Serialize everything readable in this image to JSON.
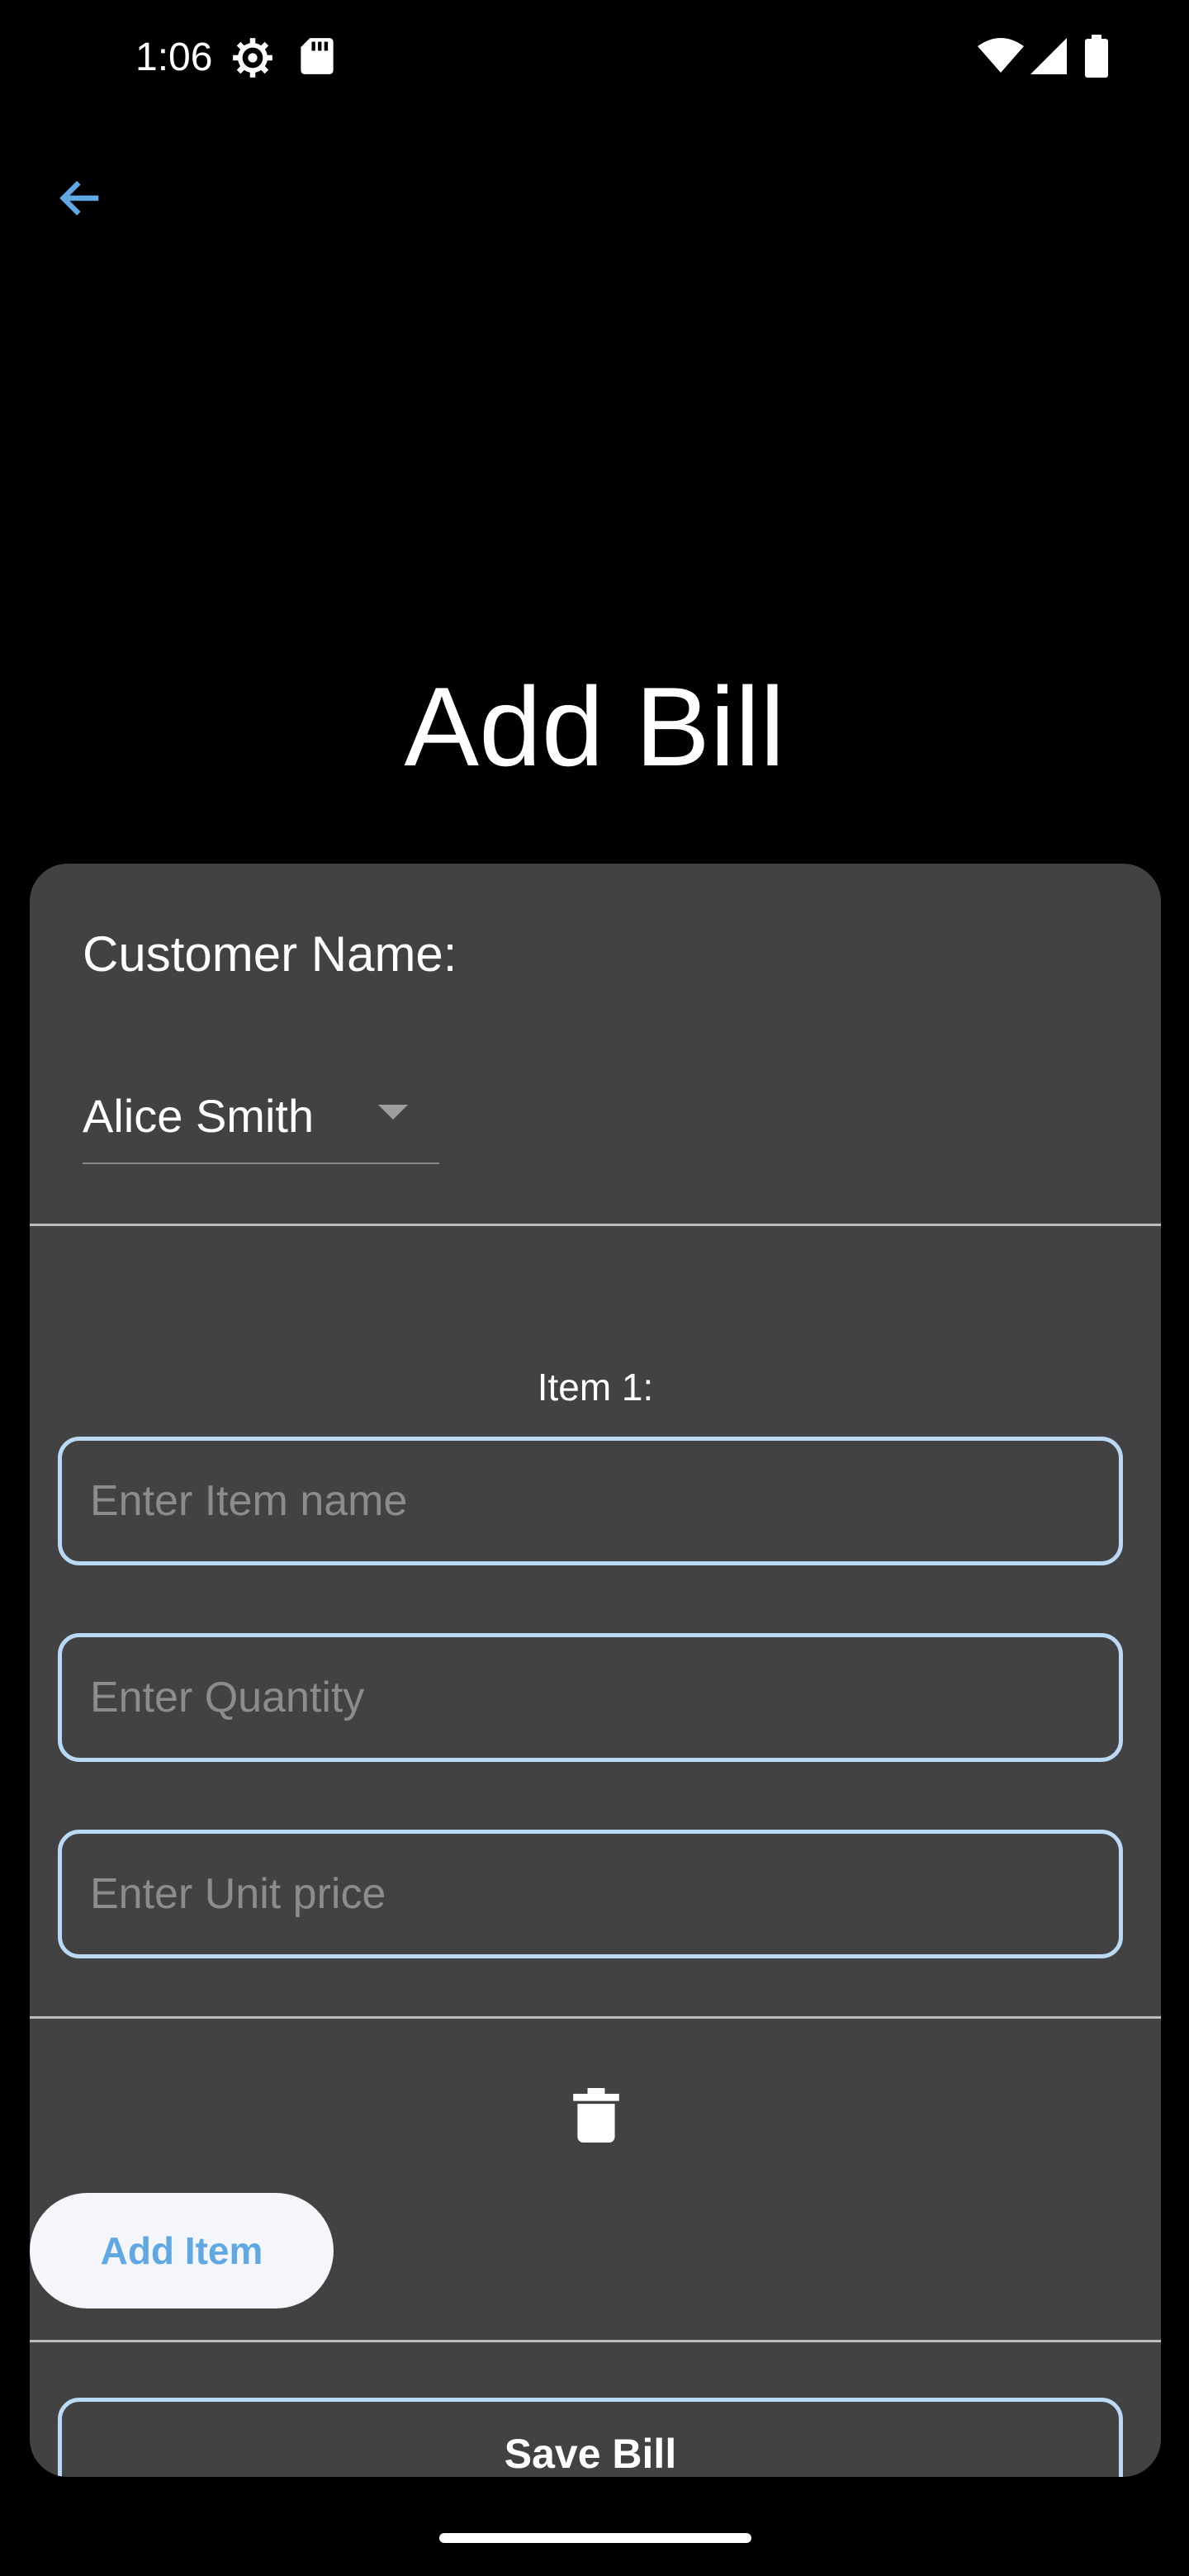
{
  "status_bar": {
    "time": "1:06",
    "icons": [
      "settings-gear-icon",
      "sd-card-icon",
      "wifi-icon",
      "cell-signal-icon",
      "battery-icon"
    ]
  },
  "header": {
    "back_icon": "arrow-left-icon",
    "title": "Add Bill"
  },
  "colors": {
    "background": "#000000",
    "card": "#424242",
    "accent": "#5fa8e4",
    "field_border": "#b9d9f5",
    "placeholder": "#8c8c8c"
  },
  "form": {
    "customer_label": "Customer Name:",
    "customer_selected": "Alice Smith",
    "item_heading": "Item 1:",
    "item_name_placeholder": "Enter Item name",
    "quantity_placeholder": "Enter Quantity",
    "unit_price_placeholder": "Enter Unit price",
    "delete_icon": "trash-icon",
    "add_item_label": "Add Item",
    "save_label": "Save Bill"
  }
}
